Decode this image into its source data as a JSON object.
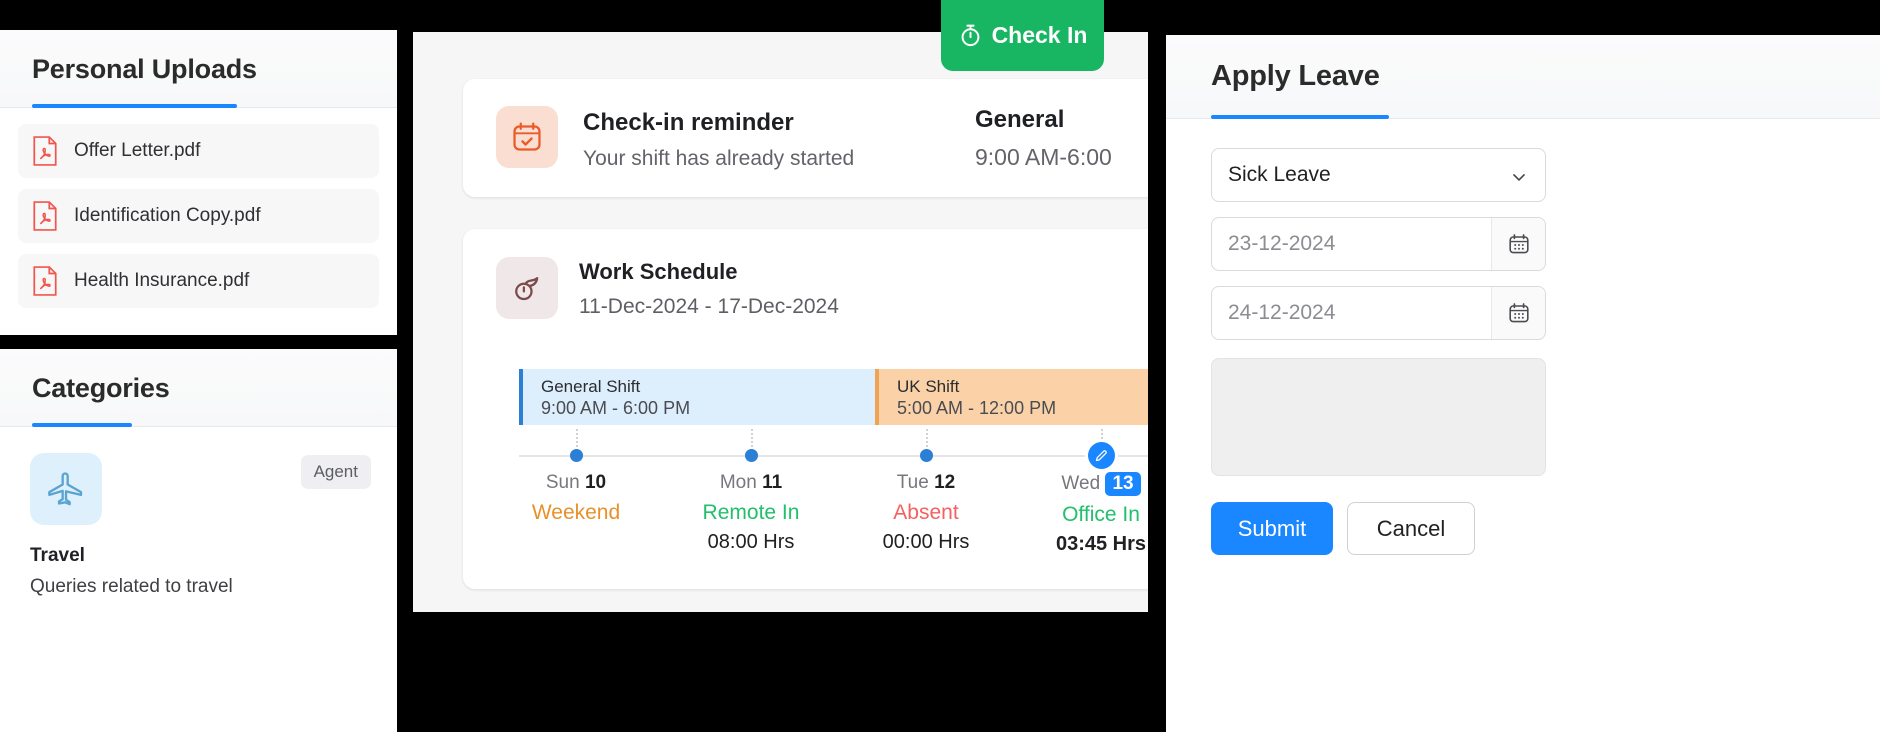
{
  "personal_uploads": {
    "title": "Personal Uploads",
    "files": [
      {
        "name": "Offer Letter.pdf",
        "icon": "pdf-file-icon"
      },
      {
        "name": "Identification Copy.pdf",
        "icon": "pdf-file-icon"
      },
      {
        "name": "Health Insurance.pdf",
        "icon": "pdf-file-icon"
      }
    ]
  },
  "categories": {
    "title": "Categories",
    "badge": "Agent",
    "item": {
      "icon": "airplane-icon",
      "name": "Travel",
      "description": "Queries related to travel"
    }
  },
  "check_in": {
    "label": "Check In",
    "icon": "stopwatch-icon",
    "color": "#18b663"
  },
  "reminder": {
    "icon": "calendar-check-icon",
    "title": "Check-in reminder",
    "subtitle": "Your shift has already started",
    "shift_name": "General",
    "shift_time": "9:00 AM-6:00"
  },
  "work_schedule": {
    "icon": "clock-moon-icon",
    "title": "Work Schedule",
    "date_range": "11-Dec-2024  -  17-Dec-2024",
    "shifts": [
      {
        "name": "General Shift",
        "time": "9:00 AM - 6:00 PM",
        "bg": "#ddeefc",
        "accent": "#2b7fd4"
      },
      {
        "name": "UK Shift",
        "time": "5:00 AM - 12:00 PM",
        "bg": "#fbd2a8",
        "accent": "#f0a353"
      }
    ],
    "days": [
      {
        "weekday": "Sun",
        "date": "10",
        "status": "Weekend",
        "status_color": "#e8912b",
        "hours": "",
        "highlight": false,
        "edit": false
      },
      {
        "weekday": "Mon",
        "date": "11",
        "status": "Remote In",
        "status_color": "#21c06b",
        "hours": "08:00 Hrs",
        "highlight": false,
        "edit": false
      },
      {
        "weekday": "Tue",
        "date": "12",
        "status": "Absent",
        "status_color": "#f4615f",
        "hours": "00:00 Hrs",
        "highlight": false,
        "edit": false
      },
      {
        "weekday": "Wed",
        "date": "13",
        "status": "Office In",
        "status_color": "#21c06b",
        "hours": "03:45 Hrs",
        "highlight": true,
        "edit": true
      }
    ]
  },
  "apply_leave": {
    "title": "Apply Leave",
    "leave_type": "Sick Leave",
    "from_date": "23-12-2024",
    "to_date": "24-12-2024",
    "note_value": "",
    "submit_label": "Submit",
    "cancel_label": "Cancel",
    "accent": "#1a86ff"
  }
}
